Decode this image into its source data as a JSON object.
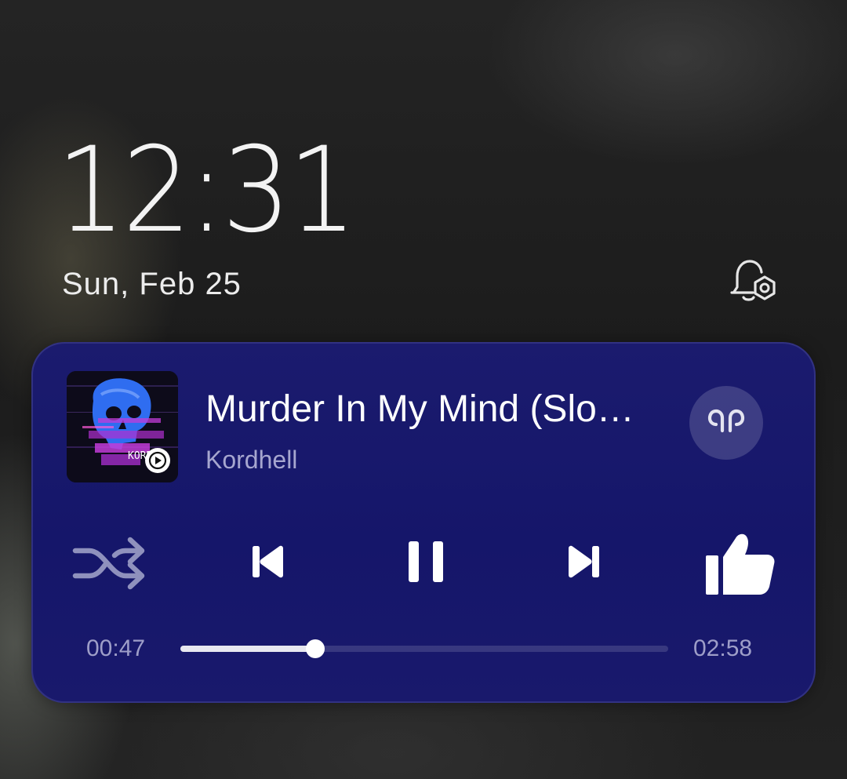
{
  "lockscreen": {
    "time": "12:31",
    "date": "Sun, Feb 25"
  },
  "icons": {
    "notification_settings": "bell-settings-icon",
    "earbuds": "earbuds-icon",
    "shuffle": "shuffle-icon",
    "previous": "skip-previous-icon",
    "pause": "pause-icon",
    "next": "skip-next-icon",
    "like": "thumbs-up-icon",
    "app_badge": "play-circle-icon"
  },
  "player": {
    "title": "Murder In My Mind (Slo…",
    "artist": "Kordhell",
    "elapsed": "00:47",
    "duration": "02:58",
    "progress": 0.277,
    "art_caption": "KORD",
    "colors": {
      "card": "#17176b",
      "accent_text": "#a6a6cf",
      "skull": "#2f6df0",
      "glitch": "#c23cd8"
    }
  }
}
